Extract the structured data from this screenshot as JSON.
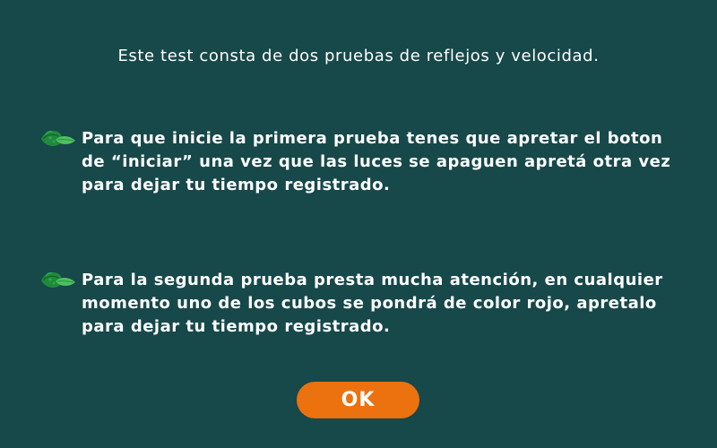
{
  "intro_text": "Este test consta de dos pruebas de reflejos y velocidad.",
  "instructions": [
    {
      "icon": "leaf-icon",
      "text": "Para que inicie la primera prueba tenes que apretar el boton de “iniciar” una vez que las luces se apaguen apretá otra vez para dejar tu tiempo registrado."
    },
    {
      "icon": "leaf-icon",
      "text": "Para la segunda prueba presta mucha atención, en cualquier momento uno de los cubos se pondrá de color rojo, apretalo para dejar tu tiempo registrado."
    }
  ],
  "ok_button_label": "OK",
  "colors": {
    "background": "#17484a",
    "text": "#ffffff",
    "button": "#ec710f",
    "leaf_dark": "#1e8a3c",
    "leaf_light": "#4fbf5f"
  }
}
